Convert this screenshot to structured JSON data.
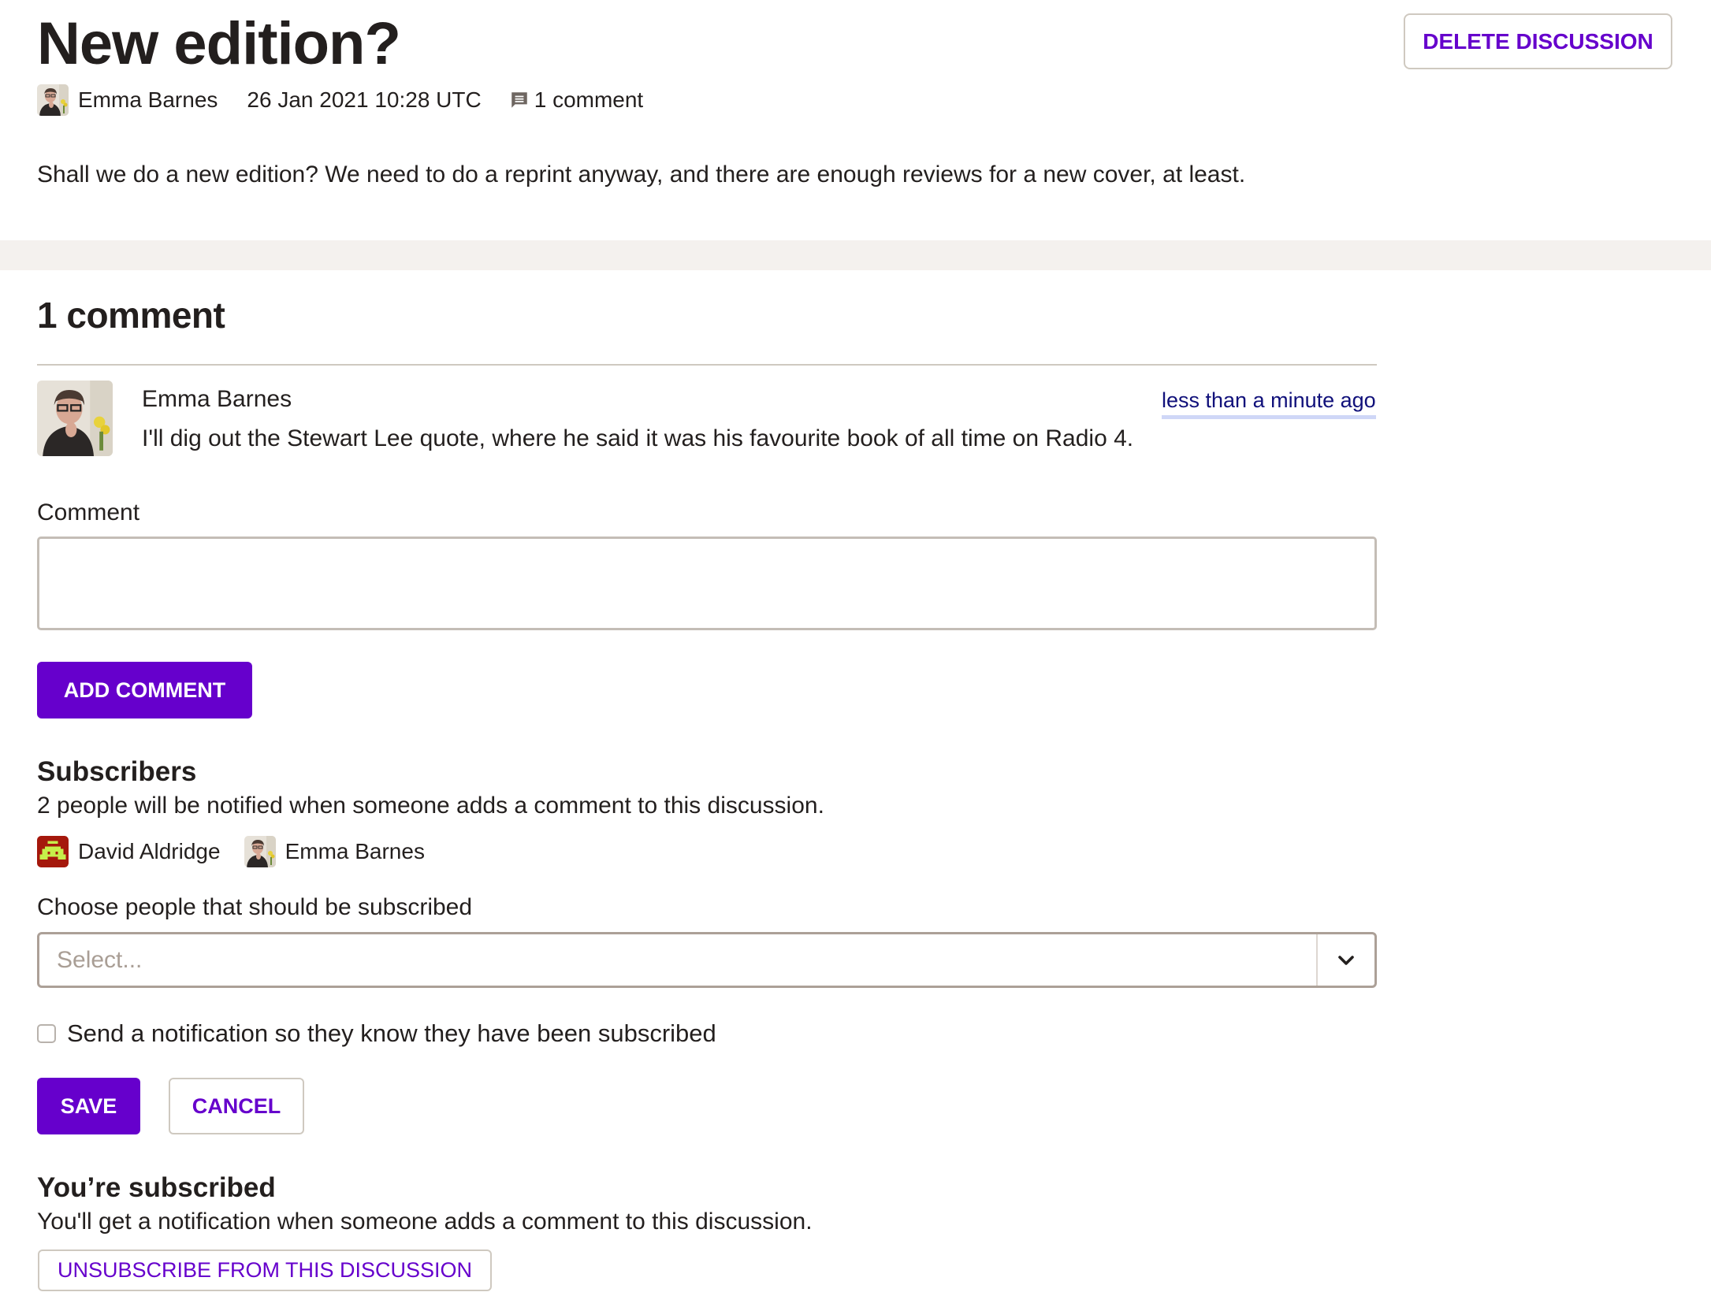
{
  "discussion": {
    "title": "New edition?",
    "author": "Emma Barnes",
    "date": "26 Jan 2021 10:28 UTC",
    "comment_count_label": "1 comment",
    "body": "Shall we do a new edition? We need to do a reprint anyway, and there are enough reviews for a new cover, at least.",
    "delete_label": "DELETE DISCUSSION"
  },
  "comments": {
    "heading": "1 comment",
    "items": [
      {
        "author": "Emma Barnes",
        "time": "less than a minute ago",
        "text": "I'll dig out the Stewart Lee quote, where he said it was his favourite book of all time on Radio 4."
      }
    ],
    "form": {
      "label": "Comment",
      "value": "",
      "submit_label": "ADD COMMENT"
    }
  },
  "subscribers": {
    "heading": "Subscribers",
    "description": "2 people will be notified when someone adds a comment to this discussion.",
    "people": [
      {
        "name": "David Aldridge",
        "avatar": "space-invader-avatar"
      },
      {
        "name": "Emma Barnes",
        "avatar": "photo-avatar"
      }
    ],
    "choose_label": "Choose people that should be subscribed",
    "select_placeholder": "Select...",
    "notify_label": "Send a notification so they know they have been subscribed",
    "notify_checked": false,
    "save_label": "SAVE",
    "cancel_label": "CANCEL"
  },
  "your_subscription": {
    "heading": "You’re subscribed",
    "description": "You'll get a notification when someone adds a comment to this discussion.",
    "unsubscribe_label": "UNSUBSCRIBE FROM THIS DISCUSSION"
  },
  "colors": {
    "accent": "#6600cc",
    "text": "#231f1e",
    "link": "#10107a",
    "link_underline": "#cfd7f7",
    "band": "#f4f1ee",
    "border": "#cfc9c0"
  }
}
